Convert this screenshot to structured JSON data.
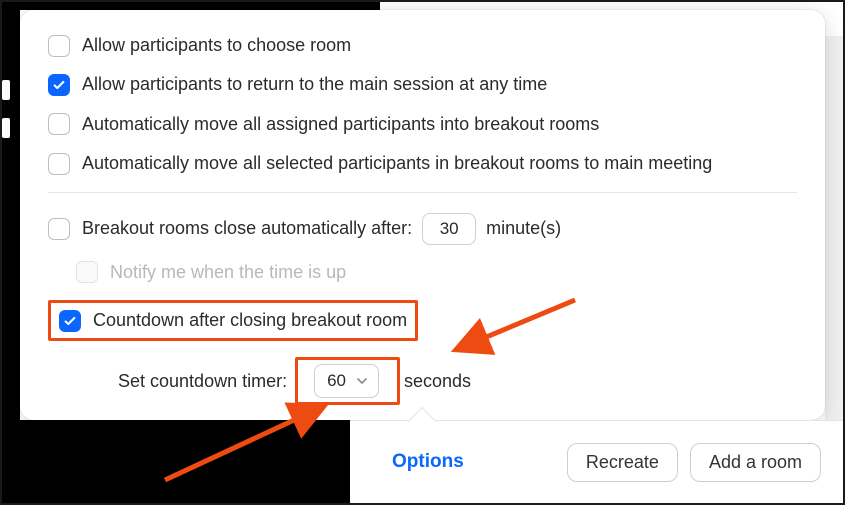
{
  "options": {
    "choose_room": {
      "label": "Allow participants to choose room",
      "checked": false
    },
    "return_main": {
      "label": "Allow participants to return to the main session at any time",
      "checked": true
    },
    "auto_move_into": {
      "label": "Automatically move all assigned participants into breakout rooms",
      "checked": false
    },
    "auto_move_main": {
      "label": "Automatically move all selected participants in breakout rooms to main meeting",
      "checked": false
    },
    "auto_close": {
      "label_before": "Breakout rooms close automatically after:",
      "value": "30",
      "label_after": "minute(s)",
      "checked": false
    },
    "notify": {
      "label": "Notify me when the time is up",
      "checked": false,
      "disabled": true
    },
    "countdown": {
      "label": "Countdown after closing breakout room",
      "checked": true
    },
    "timer": {
      "label_before": "Set countdown timer:",
      "value": "60",
      "label_after": "seconds"
    }
  },
  "footer": {
    "options": "Options",
    "recreate": "Recreate",
    "add_room": "Add a room"
  },
  "colors": {
    "accent": "#0b66ff",
    "highlight": "#ee4b12"
  }
}
